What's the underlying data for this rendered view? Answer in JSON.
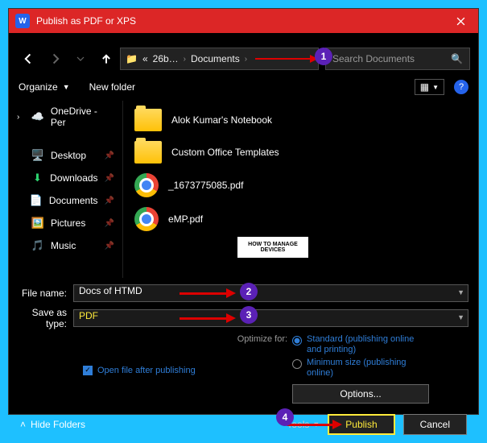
{
  "title": "Publish as PDF or XPS",
  "nav": {
    "breadcrumb": [
      "26b…",
      "Documents"
    ],
    "search_placeholder": "Search Documents"
  },
  "toolbar": {
    "organize": "Organize",
    "new_folder": "New folder"
  },
  "sidebar": {
    "onedrive": "OneDrive - Per",
    "items": [
      "Desktop",
      "Downloads",
      "Documents",
      "Pictures",
      "Music"
    ]
  },
  "files": [
    {
      "name": "Alok Kumar's Notebook",
      "type": "folder"
    },
    {
      "name": "Custom Office Templates",
      "type": "folder"
    },
    {
      "name": "_1673775085.pdf",
      "type": "pdf"
    },
    {
      "name": "eMP.pdf",
      "type": "pdf"
    }
  ],
  "form": {
    "file_name_label": "File name:",
    "file_name": "Docs of HTMD",
    "save_type_label": "Save as type:",
    "save_type": "PDF",
    "open_after": "Open file after publishing",
    "optimize_label": "Optimize for:",
    "option_standard": "Standard (publishing online and printing)",
    "option_minimum": "Minimum size (publishing online)",
    "options_btn": "Options..."
  },
  "footer": {
    "hide": "Hide Folders",
    "tools": "Tools",
    "publish": "Publish",
    "cancel": "Cancel"
  },
  "howto": "HOW TO MANAGE DEVICES",
  "callouts": [
    "1",
    "2",
    "3",
    "4"
  ]
}
